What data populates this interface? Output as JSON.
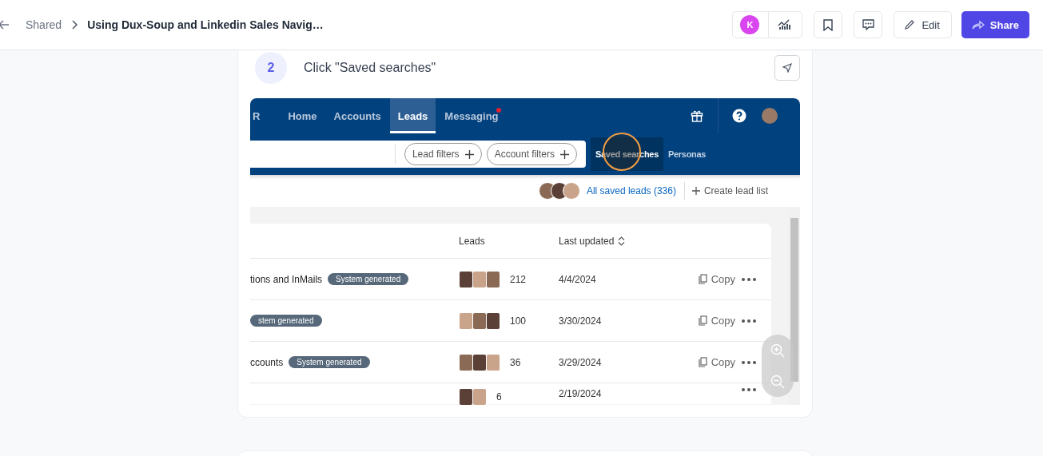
{
  "header": {
    "breadcrumb_parent": "Shared",
    "title": "Using Dux-Soup and Linkedin Sales Navig…",
    "avatar_initial": "K",
    "edit_label": "Edit",
    "share_label": "Share"
  },
  "step": {
    "number": "2",
    "text": "Click \"Saved searches\""
  },
  "screenshot": {
    "nav_items": [
      {
        "label": "R",
        "selected": false,
        "notification": false
      },
      {
        "label": "Home",
        "selected": false,
        "notification": false
      },
      {
        "label": "Accounts",
        "selected": false,
        "notification": false
      },
      {
        "label": "Leads",
        "selected": true,
        "notification": false
      },
      {
        "label": "Messaging",
        "selected": false,
        "notification": true
      }
    ],
    "filters": [
      "Lead filters",
      "Account filters"
    ],
    "tabs": [
      {
        "label": "Saved searches",
        "selected": true
      },
      {
        "label": "Personas",
        "selected": false
      }
    ],
    "saved_leads_link": "All saved leads (336)",
    "create_list": "Create lead list",
    "columns": [
      "Leads",
      "Last updated"
    ],
    "rows": [
      {
        "name": "tions and InMails",
        "badge": "System generated",
        "leads": "212",
        "updated": "4/4/2024",
        "copy": "Copy"
      },
      {
        "badge": "stem generated",
        "leads": "100",
        "updated": "3/30/2024",
        "copy": "Copy"
      },
      {
        "name": "ccounts",
        "badge": "System generated",
        "leads": "36",
        "updated": "3/29/2024",
        "copy": "Copy"
      },
      {
        "leads": "6",
        "updated": "2/19/2024"
      }
    ]
  }
}
